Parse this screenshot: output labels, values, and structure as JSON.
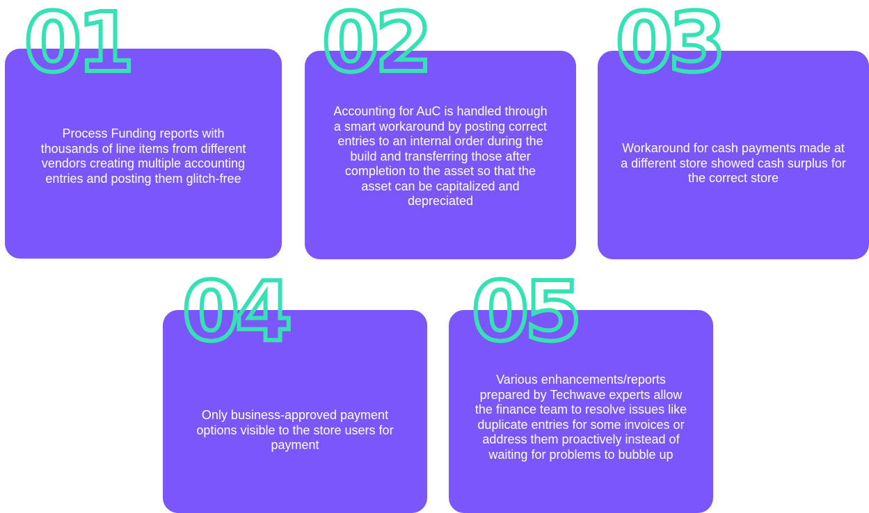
{
  "colors": {
    "card_background": "#7b57fb",
    "number_outline": "#36e2b4",
    "text": "#ffffff",
    "page_background": "#ffffff"
  },
  "cards": [
    {
      "number": "01",
      "text": "Process Funding reports with thousands of line items from different vendors creating multiple accounting entries and posting them glitch-free"
    },
    {
      "number": "02",
      "text": "Accounting for AuC is handled through a smart workaround by posting correct entries to an internal order during the build and transferring those after completion to the asset so that the asset can be capitalized and depreciated"
    },
    {
      "number": "03",
      "text": "Workaround for cash payments made at a different store showed cash surplus for the correct store"
    },
    {
      "number": "04",
      "text": "Only business-approved payment options visible to the store users for payment"
    },
    {
      "number": "05",
      "text": "Various enhancements/reports prepared by Techwave experts allow the finance team to resolve issues like duplicate entries for some invoices or address them proactively instead of waiting for problems to bubble up"
    }
  ]
}
